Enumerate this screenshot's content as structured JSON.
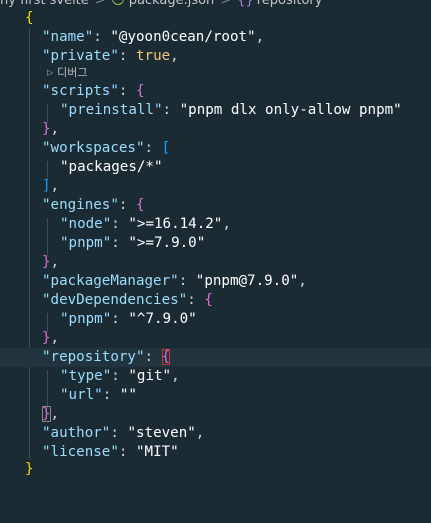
{
  "breadcrumb": {
    "folder": "ny first svelte",
    "file": "package.json",
    "symbol": "repository",
    "separator": ">",
    "symbol_icon": "{}"
  },
  "codelens": {
    "label": "디버그"
  },
  "code": {
    "open_root": "{",
    "close_root": "}",
    "name_key": "name",
    "name_value": "@yoon0cean/root",
    "private_key": "private",
    "private_value": "true",
    "scripts_key": "scripts",
    "preinstall_key": "preinstall",
    "preinstall_value": "pnpm dlx only-allow pnpm",
    "workspaces_key": "workspaces",
    "workspaces_item": "packages/*",
    "engines_key": "engines",
    "node_key": "node",
    "node_value": ">=16.14.2",
    "pnpm_key": "pnpm",
    "pnpm_value": ">=7.9.0",
    "packageManager_key": "packageManager",
    "packageManager_value": "pnpm@7.9.0",
    "devDependencies_key": "devDependencies",
    "dev_pnpm_key": "pnpm",
    "dev_pnpm_value": "^7.9.0",
    "repository_key": "repository",
    "type_key": "type",
    "type_value": "git",
    "url_key": "url",
    "url_value": "",
    "author_key": "author",
    "author_value": "steven",
    "license_key": "license",
    "license_value": "MIT"
  },
  "colors": {
    "background": "#1b2b34",
    "key": "#9cdcfe",
    "string": "#ffffff",
    "brace_level1": "#ffd700",
    "brace_level2": "#da70d6",
    "bracket_level2": "#179fff",
    "current_line": "#22353f"
  }
}
